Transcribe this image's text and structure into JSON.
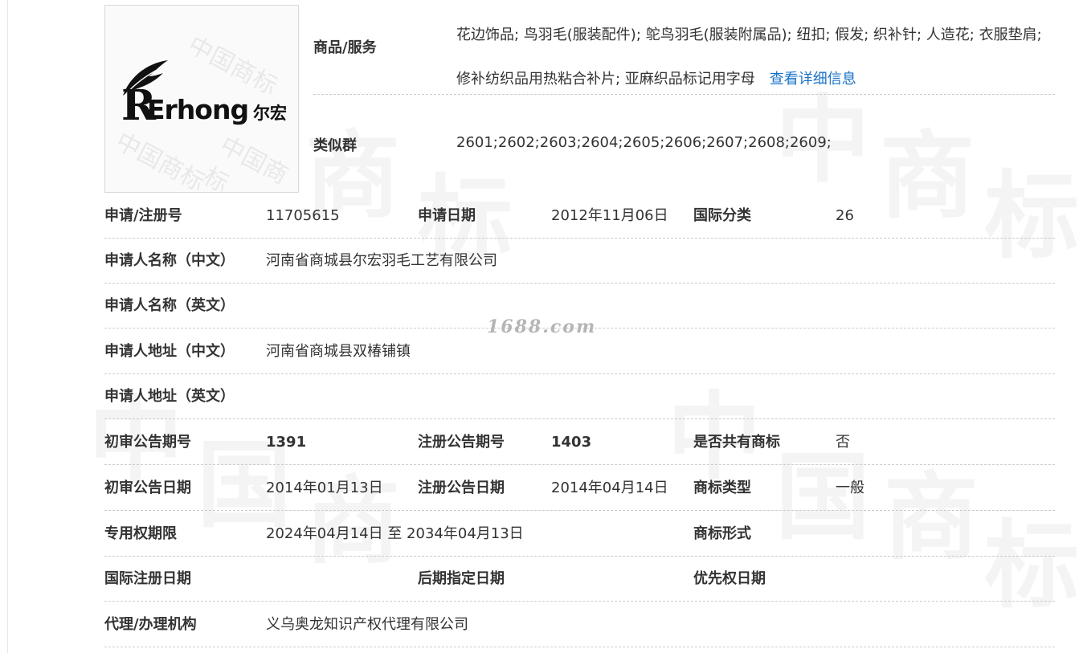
{
  "logo": {
    "letter": "R",
    "word": "Erhong",
    "cn": "尔宏"
  },
  "goods_label": "商品/服务",
  "goods_text": "花边饰品; 鸟羽毛(服装配件); 鸵鸟羽毛(服装附属品); 纽扣; 假发; 织补针; 人造花; 衣服垫肩; 修补纺织品用热粘合补片; 亚麻织品标记用字母",
  "goods_link": "查看详细信息",
  "similar_label": "类似群",
  "similar_value": "2601;2602;2603;2604;2605;2606;2607;2608;2609;",
  "rows": [
    {
      "l1": "申请/注册号",
      "v1": "11705615",
      "l2": "申请日期",
      "v2": "2012年11月06日",
      "l3": "国际分类",
      "v3": "26"
    },
    {
      "l1": "申请人名称（中文）",
      "v1": "河南省商城县尔宏羽毛工艺有限公司"
    },
    {
      "l1": "申请人名称（英文）",
      "v1": ""
    },
    {
      "l1": "申请人地址（中文）",
      "v1": "河南省商城县双椿铺镇"
    },
    {
      "l1": "申请人地址（英文）",
      "v1": ""
    },
    {
      "l1": "初审公告期号",
      "v1": "1391",
      "l2": "注册公告期号",
      "v2": "1403",
      "l3": "是否共有商标",
      "v3": "否"
    },
    {
      "l1": "初审公告日期",
      "v1": "2014年01月13日",
      "l2": "注册公告日期",
      "v2": "2014年04月14日",
      "l3": "商标类型",
      "v3": "一般"
    },
    {
      "l1": "专用权期限",
      "v1": "2024年04月14日 至 2034年04月13日",
      "l3": "商标形式",
      "v3": ""
    },
    {
      "l1": "国际注册日期",
      "v1": "",
      "l2": "后期指定日期",
      "v2": "",
      "l3": "优先权日期",
      "v3": ""
    },
    {
      "l1": "代理/办理机构",
      "v1": "义乌奥龙知识产权代理有限公司"
    }
  ],
  "watermark_site": "1688.com",
  "watermark_chars": [
    "中",
    "国",
    "商",
    "标"
  ],
  "colors": {
    "link": "#1a73c8",
    "text": "#333333",
    "divider": "#cccccc"
  }
}
